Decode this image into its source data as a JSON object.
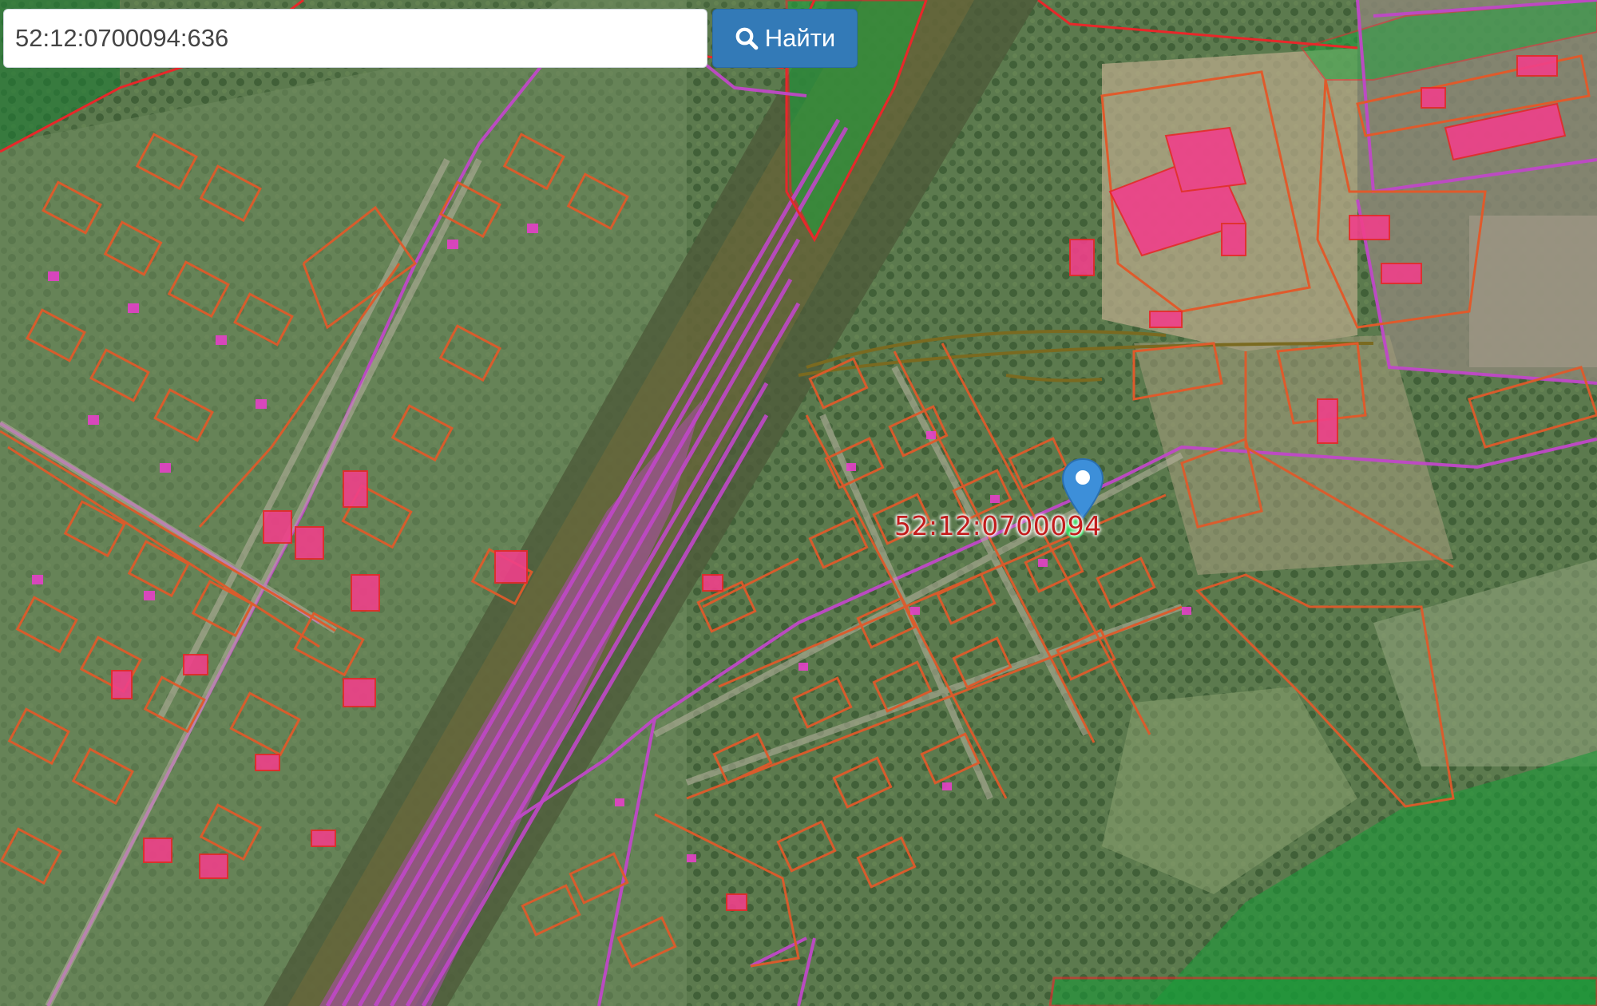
{
  "search": {
    "value": "52:12:0700094:636",
    "placeholder": "",
    "button_label": "Найти",
    "button_icon": "search-icon"
  },
  "map": {
    "marker_icon": "map-pin-icon",
    "parcel_label": "52:12:0700094",
    "colors": {
      "parcel_border": "#e05a2b",
      "zone_border": "#e8272a",
      "cadastral_quarter": "#c048c8",
      "building_fill": "#f0408a",
      "forest_zone": "#1aa43c",
      "marker": "#3d8fd9"
    }
  }
}
